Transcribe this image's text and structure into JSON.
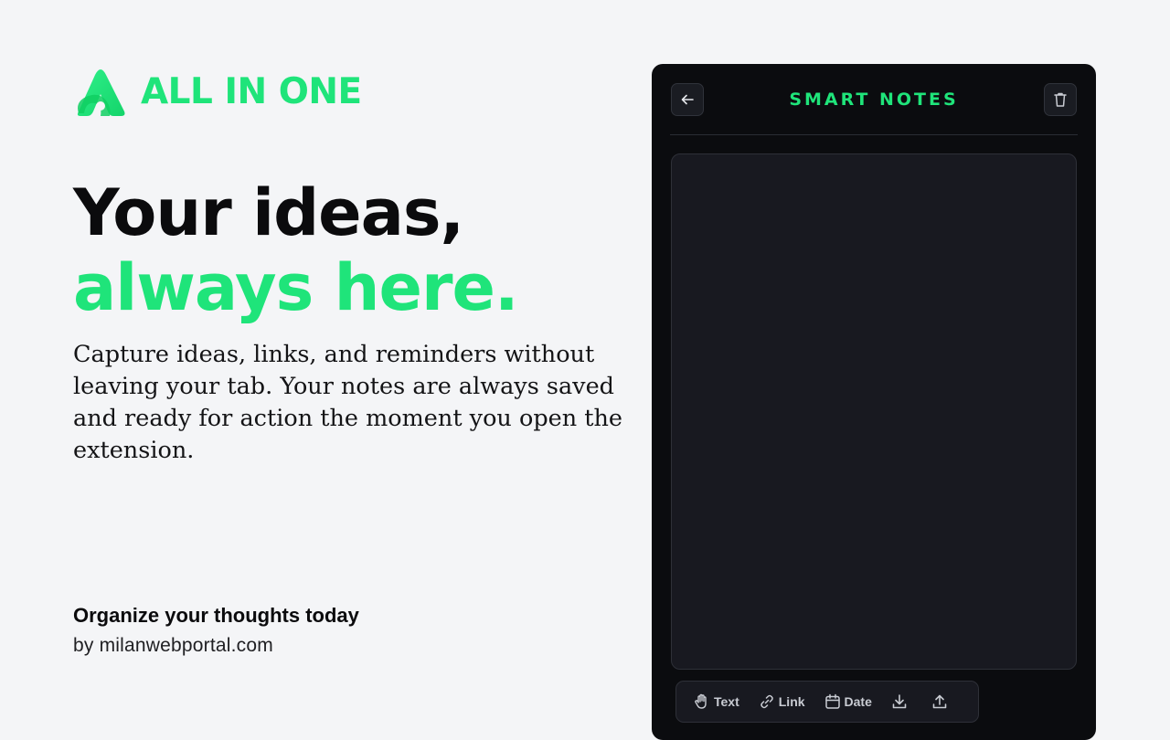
{
  "brand": {
    "name": "ALL IN ONE",
    "logo_icon": "brand-a-logo"
  },
  "hero": {
    "headline_line1": "Your ideas,",
    "headline_line2": "always here.",
    "description": "Capture ideas, links, and reminders without leaving your tab. Your notes are always saved and ready for action the moment you open the extension."
  },
  "footer": {
    "tagline": "Organize your thoughts today",
    "byline": "by milanwebportal.com"
  },
  "panel": {
    "title": "SMART NOTES",
    "back_icon": "arrow-left-icon",
    "delete_icon": "trash-icon",
    "note_value": "",
    "toolbar": {
      "text_label": "Text",
      "link_label": "Link",
      "date_label": "Date",
      "download_icon": "download-icon",
      "upload_icon": "upload-icon"
    }
  },
  "colors": {
    "accent": "#1fe47a",
    "page_background": "#f4f5f7",
    "panel_background": "#0b0c0f",
    "surface": "#181920",
    "headline_dark": "#0b0b0d"
  }
}
